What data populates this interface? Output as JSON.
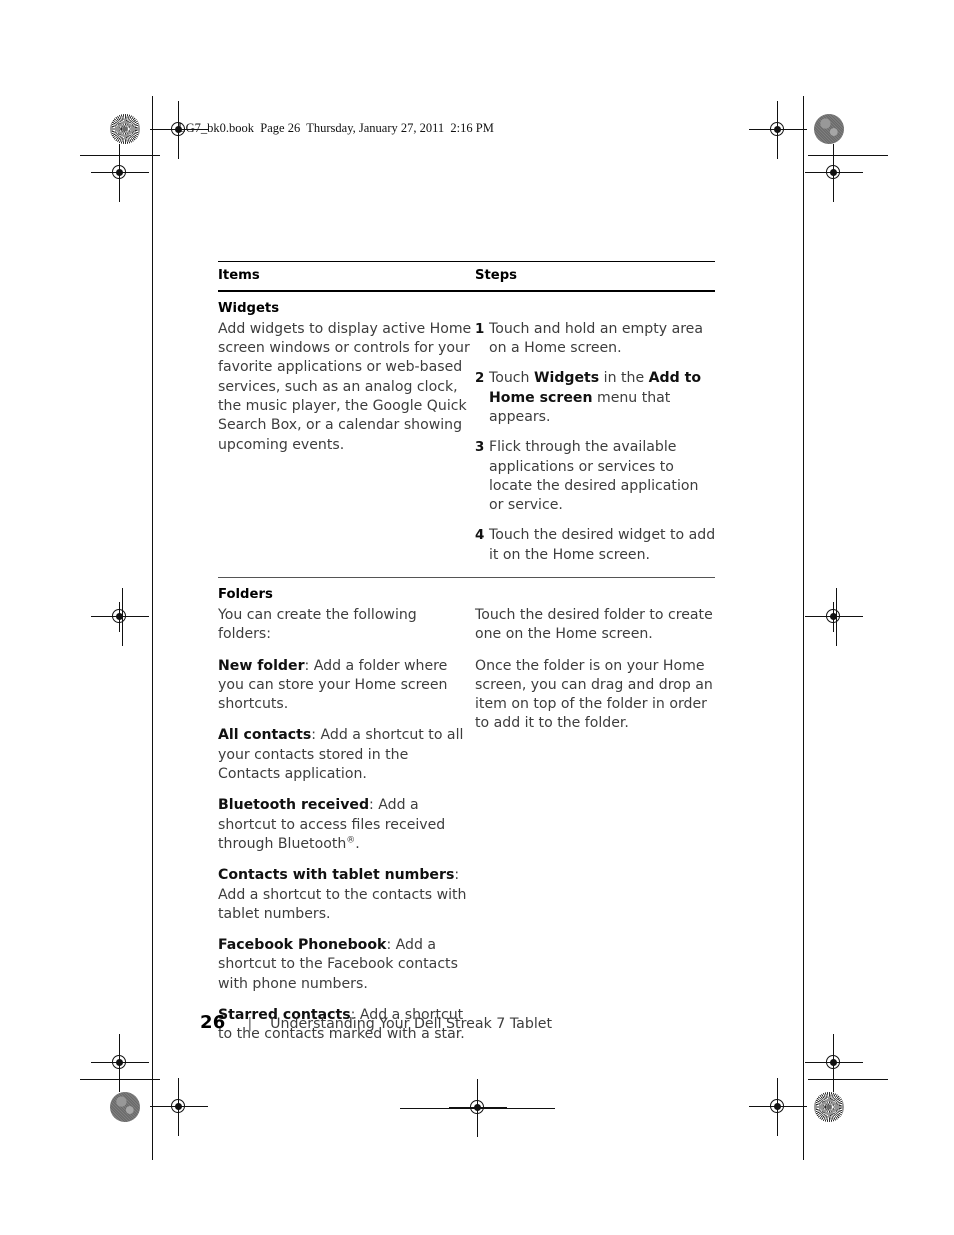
{
  "page": {
    "running_header": "LG7_bk0.book  Page 26  Thursday, January 27, 2011  2:16 PM",
    "footer_page_number": "26",
    "footer_separator": "|",
    "footer_title": "Understanding Your Dell Streak 7 Tablet"
  },
  "table": {
    "headers": {
      "items": "Items",
      "steps": "Steps"
    },
    "widgets": {
      "title": "Widgets",
      "description": "Add widgets to display active Home screen windows or controls for your favorite applications or web-based services, such as an analog clock, the music player, the Google Quick Search Box, or a calendar showing upcoming events.",
      "steps": [
        {
          "num": "1",
          "text": "Touch and hold an empty area on a Home screen."
        },
        {
          "num": "2",
          "text_before": "Touch ",
          "bold1": "Widgets",
          "text_mid": " in the ",
          "bold2": "Add to Home screen",
          "text_after": " menu that appears."
        },
        {
          "num": "3",
          "text": "Flick through the available applications or services to locate the desired application or service."
        },
        {
          "num": "4",
          "text": "Touch the desired widget to add it on the Home screen."
        }
      ]
    },
    "folders": {
      "title": "Folders",
      "intro": "You can create the following folders:",
      "items": [
        {
          "term": "New folder",
          "desc": ": Add a folder where you can store your Home screen shortcuts."
        },
        {
          "term": "All contacts",
          "desc": ": Add a shortcut to all your contacts stored in the Contacts application."
        },
        {
          "term": "Bluetooth received",
          "desc": ": Add a shortcut to access files received through Bluetooth",
          "superscript": "®",
          "desc_tail": "."
        },
        {
          "term": "Contacts with tablet numbers",
          "desc": ": Add a shortcut to the contacts with tablet numbers."
        },
        {
          "term": "Facebook Phonebook",
          "desc": ": Add a shortcut to the Facebook contacts with phone numbers."
        },
        {
          "term": "Starred contacts",
          "desc": ": Add a shortcut to the contacts marked with a star."
        }
      ],
      "steps_paragraphs": [
        "Touch the desired folder to create one on the Home screen.",
        "Once the folder is on your Home screen, you can drag and drop an item on top of the folder in order to add it to the folder."
      ]
    }
  }
}
